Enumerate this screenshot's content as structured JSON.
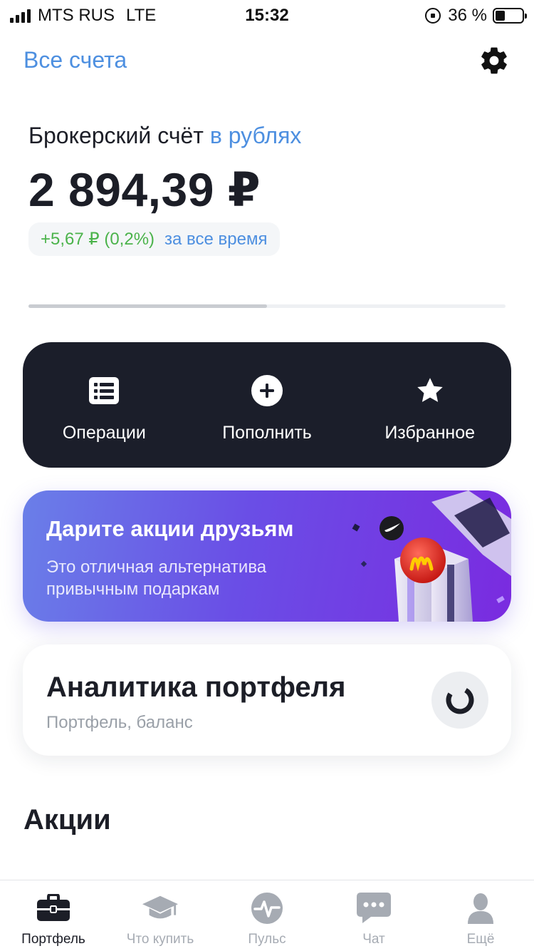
{
  "status_bar": {
    "carrier": "MTS RUS",
    "network": "LTE",
    "time": "15:32",
    "battery": "36 %",
    "battery_level": 0.36
  },
  "header": {
    "all_accounts": "Все счета",
    "settings_icon": "gear-icon"
  },
  "account": {
    "type_label": "Брокерский счёт",
    "currency_label": "в рублях",
    "balance": "2 894,39 ₽",
    "change": "+5,67 ₽ (0,2%)",
    "change_period": "за все время",
    "pager_active_fraction": 0.5
  },
  "actions": [
    {
      "label": "Операции",
      "icon": "list-icon"
    },
    {
      "label": "Пополнить",
      "icon": "plus-circle-icon"
    },
    {
      "label": "Избранное",
      "icon": "star-icon"
    }
  ],
  "promo": {
    "title": "Дарите акции друзьям",
    "subtitle": "Это отличная альтернатива привычным подаркам"
  },
  "analytics": {
    "title": "Аналитика портфеля",
    "subtitle": "Портфель, баланс",
    "icon": "donut-chart-icon"
  },
  "section": {
    "title": "Акции"
  },
  "tabbar": [
    {
      "label": "Портфель",
      "icon": "briefcase-icon",
      "active": true
    },
    {
      "label": "Что купить",
      "icon": "graduation-cap-icon",
      "active": false
    },
    {
      "label": "Пульс",
      "icon": "pulse-icon",
      "active": false
    },
    {
      "label": "Чат",
      "icon": "chat-icon",
      "active": false
    },
    {
      "label": "Ещё",
      "icon": "profile-icon",
      "active": false
    }
  ],
  "colors": {
    "accent_blue": "#4d8fe0",
    "positive_green": "#4bb34b",
    "dark_panel": "#1b1e2a"
  }
}
